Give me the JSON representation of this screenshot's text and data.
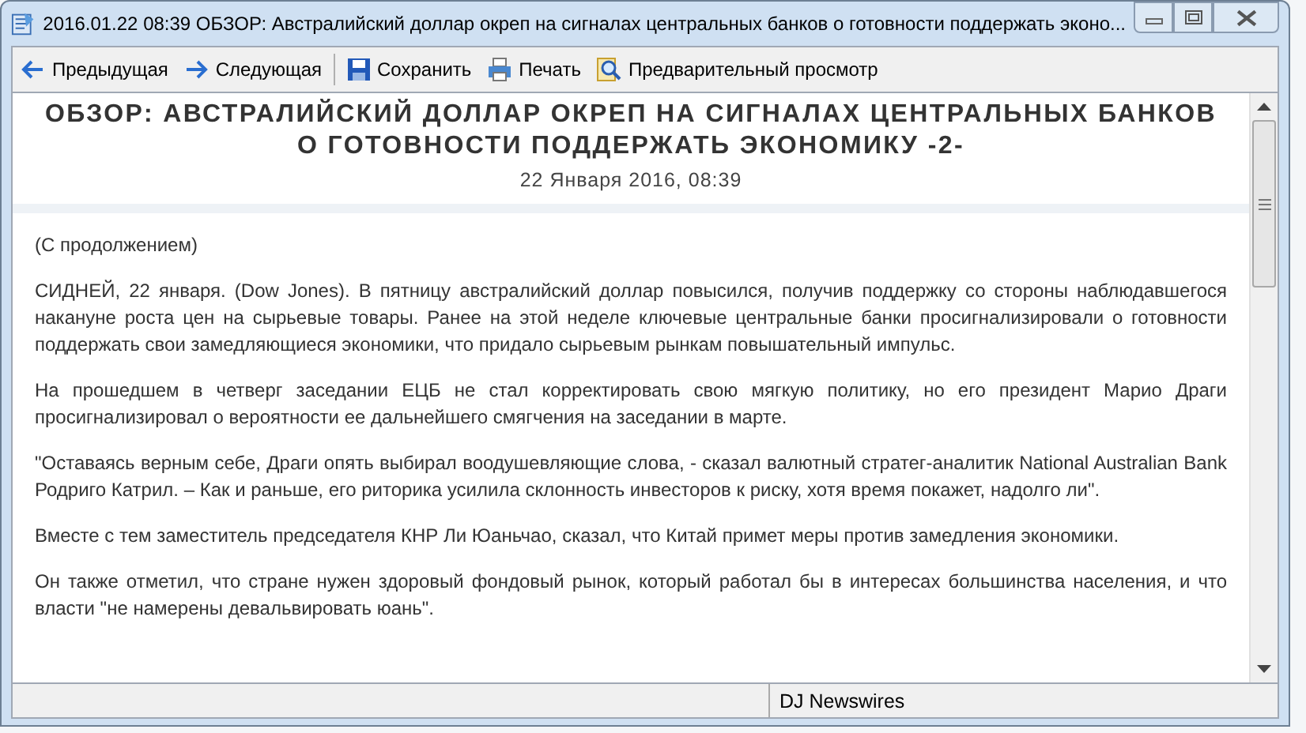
{
  "window": {
    "title": "2016.01.22 08:39 ОБЗОР: Австралийский доллар окреп на сигналах центральных банков о готовности поддержать эконо..."
  },
  "toolbar": [
    {
      "kind": "back",
      "label": "Предыдущая"
    },
    {
      "kind": "forward",
      "label": "Следующая"
    },
    {
      "kind": "save",
      "label": "Сохранить"
    },
    {
      "kind": "print",
      "label": "Печать"
    },
    {
      "kind": "preview",
      "label": "Предварительный просмотр"
    }
  ],
  "article": {
    "headline": "ОБЗОР: АВСТРАЛИЙСКИЙ ДОЛЛАР ОКРЕП НА СИГНАЛАХ ЦЕНТРАЛЬНЫХ БАНКОВ О ГОТОВНОСТИ ПОДДЕРЖАТЬ ЭКОНОМИКУ -2-",
    "date": "22 Января 2016, 08:39",
    "paragraphs": [
      "(С продолжением)",
      "СИДНЕЙ, 22 января. (Dow Jones). В пятницу австралийский доллар повысился, получив поддержку со стороны наблюдавшегося накануне роста цен на сырьевые товары. Ранее на этой неделе ключевые центральные банки просигнализировали о готовности поддержать свои замедляющиеся экономики, что придало сырьевым рынкам повышательный импульс.",
      "На прошедшем в четверг заседании ЕЦБ не стал корректировать свою мягкую политику, но его президент Марио Драги просигнализировал о вероятности ее дальнейшего смягчения на заседании в марте.",
      "\"Оставаясь верным себе, Драги опять выбирал воодушевляющие слова, - сказал валютный стратег-аналитик National Australian Bank Родриго Катрил. – Как и раньше, его риторика усилила склонность инвесторов к риску, хотя время покажет, надолго ли\".",
      "Вместе с тем заместитель председателя КНР Ли Юаньчао, сказал, что Китай примет меры против замедления экономики.",
      "Он также отметил, что стране нужен здоровый фондовый рынок, который работал бы в интересах большинства населения, и что власти \"не намерены девальвировать юань\"."
    ]
  },
  "status_bar": {
    "source": "DJ Newswires"
  }
}
